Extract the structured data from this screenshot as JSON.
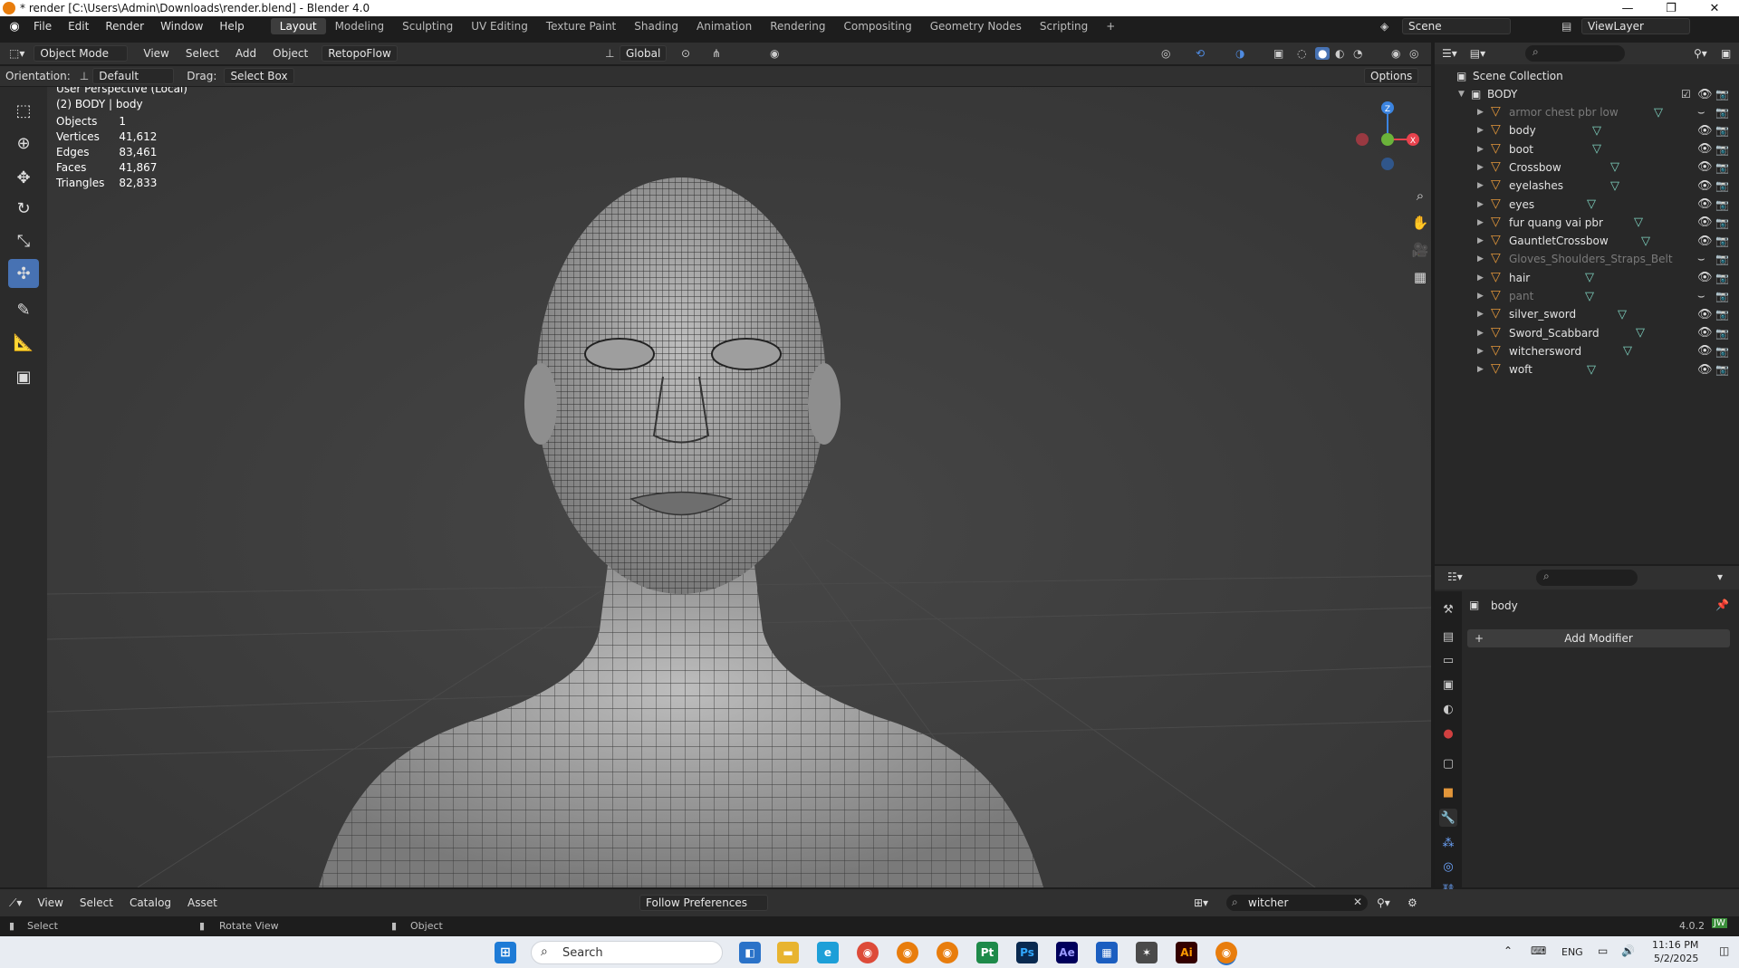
{
  "window": {
    "title": "* render [C:\\Users\\Admin\\Downloads\\render.blend] - Blender 4.0",
    "minimize_glyph": "—",
    "maximize_glyph": "❐",
    "close_glyph": "✕"
  },
  "menubar": {
    "items": [
      "File",
      "Edit",
      "Render",
      "Window",
      "Help"
    ],
    "workspaces": [
      "Layout",
      "Modeling",
      "Sculpting",
      "UV Editing",
      "Texture Paint",
      "Shading",
      "Animation",
      "Rendering",
      "Compositing",
      "Geometry Nodes",
      "Scripting"
    ],
    "active_workspace": "Layout",
    "add_workspace": "+",
    "scene": "Scene",
    "view_layer": "ViewLayer"
  },
  "viewport_header": {
    "mode": "Object Mode",
    "menus": [
      "View",
      "Select",
      "Add",
      "Object"
    ],
    "addon": "RetopoFlow",
    "transform_orientation": "Global",
    "options": "Options"
  },
  "tool_settings": {
    "orientation_label": "Orientation:",
    "orientation_value": "Default",
    "drag_label": "Drag:",
    "drag_value": "Select Box"
  },
  "viewport": {
    "perspective": "User Perspective (Local)",
    "object_info": "(2) BODY | body",
    "stats": [
      {
        "label": "Objects",
        "value": "1"
      },
      {
        "label": "Vertices",
        "value": "41,612"
      },
      {
        "label": "Edges",
        "value": "83,461"
      },
      {
        "label": "Faces",
        "value": "41,867"
      },
      {
        "label": "Triangles",
        "value": "82,833"
      }
    ],
    "gizmo": {
      "z": "Z",
      "x": "X"
    }
  },
  "outliner": {
    "root": "Scene Collection",
    "collection": "BODY",
    "objects": [
      {
        "name": "armor chest pbr low",
        "visible": false
      },
      {
        "name": "body",
        "visible": true
      },
      {
        "name": "boot",
        "visible": true
      },
      {
        "name": "Crossbow",
        "visible": true
      },
      {
        "name": "eyelashes",
        "visible": true
      },
      {
        "name": "eyes",
        "visible": true
      },
      {
        "name": "fur quang vai pbr",
        "visible": true
      },
      {
        "name": "GauntletCrossbow",
        "visible": true
      },
      {
        "name": "Gloves_Shoulders_Straps_Belt",
        "visible": false
      },
      {
        "name": "hair",
        "visible": true
      },
      {
        "name": "pant",
        "visible": false
      },
      {
        "name": "silver_sword",
        "visible": true
      },
      {
        "name": "Sword_Scabbard",
        "visible": true
      },
      {
        "name": "witchersword",
        "visible": true
      },
      {
        "name": "woft",
        "visible": true
      }
    ]
  },
  "properties": {
    "object_name": "body",
    "add_modifier": "Add Modifier"
  },
  "asset_bar": {
    "menus": [
      "View",
      "Select",
      "Catalog",
      "Asset"
    ],
    "import_method": "Follow Preferences",
    "search_value": "witcher"
  },
  "statusbar": {
    "select": "Select",
    "rotate": "Rotate View",
    "object": "Object",
    "version": "4.0.2"
  },
  "taskbar": {
    "search_placeholder": "Search",
    "language": "ENG",
    "time": "11:16 PM",
    "date": "5/2/2025",
    "apps": [
      "Pt",
      "Ps",
      "Ae",
      "Ai"
    ]
  },
  "colors": {
    "accent": "#4772b3",
    "gizmo_x": "#e8424d",
    "gizmo_y": "#6bb33a",
    "gizmo_z": "#3b84e0",
    "object_orange": "#e2963a",
    "mesh_teal": "#7fd3c0"
  }
}
